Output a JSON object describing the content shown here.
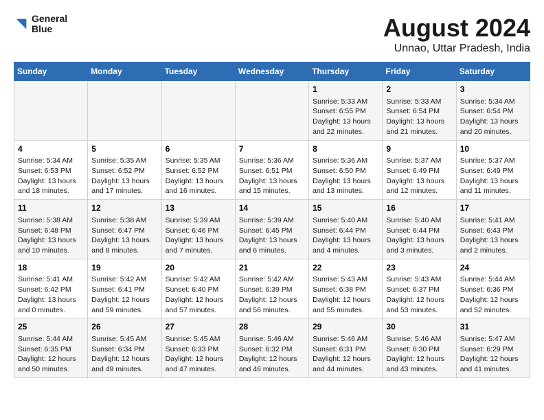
{
  "logo": {
    "line1": "General",
    "line2": "Blue"
  },
  "title": "August 2024",
  "subtitle": "Unnao, Uttar Pradesh, India",
  "weekdays": [
    "Sunday",
    "Monday",
    "Tuesday",
    "Wednesday",
    "Thursday",
    "Friday",
    "Saturday"
  ],
  "weeks": [
    [
      {
        "day": "",
        "content": ""
      },
      {
        "day": "",
        "content": ""
      },
      {
        "day": "",
        "content": ""
      },
      {
        "day": "",
        "content": ""
      },
      {
        "day": "1",
        "content": "Sunrise: 5:33 AM\nSunset: 6:55 PM\nDaylight: 13 hours\nand 22 minutes."
      },
      {
        "day": "2",
        "content": "Sunrise: 5:33 AM\nSunset: 6:54 PM\nDaylight: 13 hours\nand 21 minutes."
      },
      {
        "day": "3",
        "content": "Sunrise: 5:34 AM\nSunset: 6:54 PM\nDaylight: 13 hours\nand 20 minutes."
      }
    ],
    [
      {
        "day": "4",
        "content": "Sunrise: 5:34 AM\nSunset: 6:53 PM\nDaylight: 13 hours\nand 18 minutes."
      },
      {
        "day": "5",
        "content": "Sunrise: 5:35 AM\nSunset: 6:52 PM\nDaylight: 13 hours\nand 17 minutes."
      },
      {
        "day": "6",
        "content": "Sunrise: 5:35 AM\nSunset: 6:52 PM\nDaylight: 13 hours\nand 16 minutes."
      },
      {
        "day": "7",
        "content": "Sunrise: 5:36 AM\nSunset: 6:51 PM\nDaylight: 13 hours\nand 15 minutes."
      },
      {
        "day": "8",
        "content": "Sunrise: 5:36 AM\nSunset: 6:50 PM\nDaylight: 13 hours\nand 13 minutes."
      },
      {
        "day": "9",
        "content": "Sunrise: 5:37 AM\nSunset: 6:49 PM\nDaylight: 13 hours\nand 12 minutes."
      },
      {
        "day": "10",
        "content": "Sunrise: 5:37 AM\nSunset: 6:49 PM\nDaylight: 13 hours\nand 11 minutes."
      }
    ],
    [
      {
        "day": "11",
        "content": "Sunrise: 5:38 AM\nSunset: 6:48 PM\nDaylight: 13 hours\nand 10 minutes."
      },
      {
        "day": "12",
        "content": "Sunrise: 5:38 AM\nSunset: 6:47 PM\nDaylight: 13 hours\nand 8 minutes."
      },
      {
        "day": "13",
        "content": "Sunrise: 5:39 AM\nSunset: 6:46 PM\nDaylight: 13 hours\nand 7 minutes."
      },
      {
        "day": "14",
        "content": "Sunrise: 5:39 AM\nSunset: 6:45 PM\nDaylight: 13 hours\nand 6 minutes."
      },
      {
        "day": "15",
        "content": "Sunrise: 5:40 AM\nSunset: 6:44 PM\nDaylight: 13 hours\nand 4 minutes."
      },
      {
        "day": "16",
        "content": "Sunrise: 5:40 AM\nSunset: 6:44 PM\nDaylight: 13 hours\nand 3 minutes."
      },
      {
        "day": "17",
        "content": "Sunrise: 5:41 AM\nSunset: 6:43 PM\nDaylight: 13 hours\nand 2 minutes."
      }
    ],
    [
      {
        "day": "18",
        "content": "Sunrise: 5:41 AM\nSunset: 6:42 PM\nDaylight: 13 hours\nand 0 minutes."
      },
      {
        "day": "19",
        "content": "Sunrise: 5:42 AM\nSunset: 6:41 PM\nDaylight: 12 hours\nand 59 minutes."
      },
      {
        "day": "20",
        "content": "Sunrise: 5:42 AM\nSunset: 6:40 PM\nDaylight: 12 hours\nand 57 minutes."
      },
      {
        "day": "21",
        "content": "Sunrise: 5:42 AM\nSunset: 6:39 PM\nDaylight: 12 hours\nand 56 minutes."
      },
      {
        "day": "22",
        "content": "Sunrise: 5:43 AM\nSunset: 6:38 PM\nDaylight: 12 hours\nand 55 minutes."
      },
      {
        "day": "23",
        "content": "Sunrise: 5:43 AM\nSunset: 6:37 PM\nDaylight: 12 hours\nand 53 minutes."
      },
      {
        "day": "24",
        "content": "Sunrise: 5:44 AM\nSunset: 6:36 PM\nDaylight: 12 hours\nand 52 minutes."
      }
    ],
    [
      {
        "day": "25",
        "content": "Sunrise: 5:44 AM\nSunset: 6:35 PM\nDaylight: 12 hours\nand 50 minutes."
      },
      {
        "day": "26",
        "content": "Sunrise: 5:45 AM\nSunset: 6:34 PM\nDaylight: 12 hours\nand 49 minutes."
      },
      {
        "day": "27",
        "content": "Sunrise: 5:45 AM\nSunset: 6:33 PM\nDaylight: 12 hours\nand 47 minutes."
      },
      {
        "day": "28",
        "content": "Sunrise: 5:46 AM\nSunset: 6:32 PM\nDaylight: 12 hours\nand 46 minutes."
      },
      {
        "day": "29",
        "content": "Sunrise: 5:46 AM\nSunset: 6:31 PM\nDaylight: 12 hours\nand 44 minutes."
      },
      {
        "day": "30",
        "content": "Sunrise: 5:46 AM\nSunset: 6:30 PM\nDaylight: 12 hours\nand 43 minutes."
      },
      {
        "day": "31",
        "content": "Sunrise: 5:47 AM\nSunset: 6:29 PM\nDaylight: 12 hours\nand 41 minutes."
      }
    ]
  ]
}
